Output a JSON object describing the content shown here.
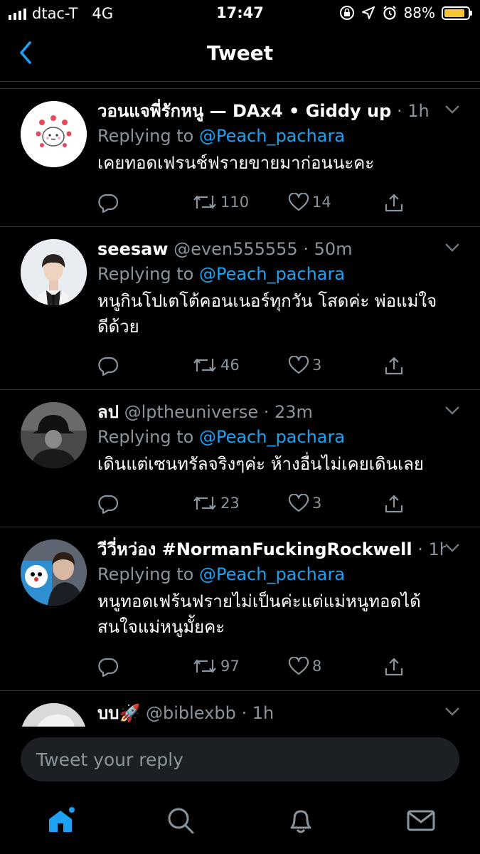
{
  "status_bar": {
    "carrier": "dtac-T",
    "network": "4G",
    "time": "17:47",
    "battery": "88%",
    "battery_level": 0.88
  },
  "nav": {
    "title": "Tweet",
    "back_icon": "chevron-left-icon",
    "accent": "#1da1f2"
  },
  "tweets": [
    {
      "name": "วอนแจพี่รักหนู — DAx4 • Giddy up",
      "handle": "",
      "time": "1h",
      "replying_label": "Replying to",
      "mention": "@Peach_pachara",
      "text": "เคยทอดเฟรนช์ฟรายขายมาก่อนนะคะ",
      "retweets": "110",
      "likes": "14"
    },
    {
      "name": "seesaw",
      "handle": "@even555555",
      "time": "50m",
      "replying_label": "Replying to",
      "mention": "@Peach_pachara",
      "text": "หนูกินโปเตโต้คอนเนอร์ทุกวัน โสดค่ะ พ่อแม่ใจดีด้วย",
      "retweets": "46",
      "likes": "3"
    },
    {
      "name": "ลป",
      "handle": "@lptheuniverse",
      "time": "23m",
      "replying_label": "Replying to",
      "mention": "@Peach_pachara",
      "text": "เดินแต่เซนทรัลจริงๆค่ะ ห้างอื่นไม่เคยเดินเลย",
      "retweets": "23",
      "likes": "3"
    },
    {
      "name": "วีวี่หว่อง #NormanFuckingRockwell",
      "handle": "",
      "time": "1h",
      "replying_label": "Replying to",
      "mention": "@Peach_pachara",
      "text": "หนูทอดเฟร้นฟรายไม่เป็นค่ะแต่แม่หนูทอดได้ สนใจแม่หนูมั้ยคะ",
      "retweets": "97",
      "likes": "8"
    },
    {
      "name": "บบ🚀",
      "handle": "@biblexbb",
      "time": "1h"
    }
  ],
  "reply_bar": {
    "placeholder": "Tweet your reply"
  },
  "tab_bar": {
    "items": [
      "home-icon",
      "search-icon",
      "notifications-icon",
      "messages-icon"
    ],
    "active": "home-icon"
  }
}
